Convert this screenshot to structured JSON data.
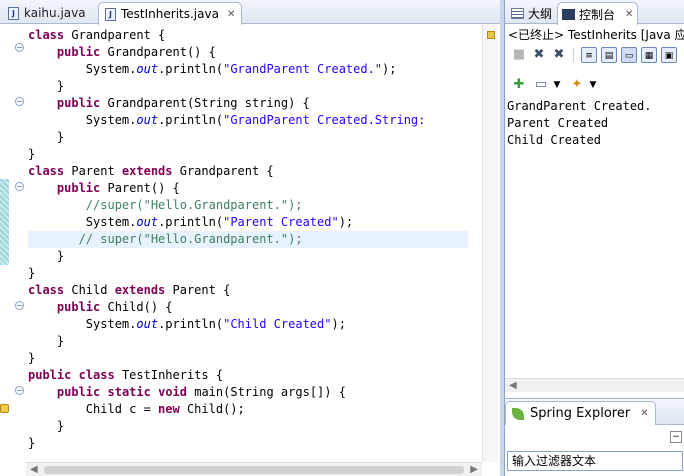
{
  "editor": {
    "tabs": [
      {
        "label": "kaihu.java",
        "active": false
      },
      {
        "label": "TestInherits.java",
        "active": true
      }
    ],
    "code": [
      [
        [
          "kw",
          "class"
        ],
        [
          "t",
          " Grandparent {"
        ]
      ],
      [
        [
          "t",
          "    "
        ],
        [
          "kw",
          "public"
        ],
        [
          "t",
          " Grandparent() {"
        ]
      ],
      [
        [
          "t",
          "        System."
        ],
        [
          "fld",
          "out"
        ],
        [
          "t",
          ".println("
        ],
        [
          "str",
          "\"GrandParent Created.\""
        ],
        [
          "t",
          ");"
        ]
      ],
      [
        [
          "t",
          "    }"
        ]
      ],
      [
        [
          "t",
          "    "
        ],
        [
          "kw",
          "public"
        ],
        [
          "t",
          " Grandparent(String string) {"
        ]
      ],
      [
        [
          "t",
          "        System."
        ],
        [
          "fld",
          "out"
        ],
        [
          "t",
          ".println("
        ],
        [
          "str",
          "\"GrandParent Created.String:"
        ]
      ],
      [
        [
          "t",
          "    }"
        ]
      ],
      [
        [
          "t",
          "}"
        ]
      ],
      [
        [
          "kw",
          "class"
        ],
        [
          "t",
          " Parent "
        ],
        [
          "kw",
          "extends"
        ],
        [
          "t",
          " Grandparent {"
        ]
      ],
      [
        [
          "t",
          "    "
        ],
        [
          "kw",
          "public"
        ],
        [
          "t",
          " Parent() {"
        ]
      ],
      [
        [
          "t",
          "        "
        ],
        [
          "cmt",
          "//super(\"Hello.Grandparent.\");"
        ]
      ],
      [
        [
          "t",
          "        System."
        ],
        [
          "fld",
          "out"
        ],
        [
          "t",
          ".println("
        ],
        [
          "str",
          "\"Parent Created\""
        ],
        [
          "t",
          ");"
        ]
      ],
      [
        [
          "t",
          "       "
        ],
        [
          "cmt",
          "// super(\"Hello.Grandparent.\");"
        ]
      ],
      [
        [
          "t",
          "    }"
        ]
      ],
      [
        [
          "t",
          "}"
        ]
      ],
      [
        [
          "kw",
          "class"
        ],
        [
          "t",
          " Child "
        ],
        [
          "kw",
          "extends"
        ],
        [
          "t",
          " Parent {"
        ]
      ],
      [
        [
          "t",
          "    "
        ],
        [
          "kw",
          "public"
        ],
        [
          "t",
          " Child() {"
        ]
      ],
      [
        [
          "t",
          "        System."
        ],
        [
          "fld",
          "out"
        ],
        [
          "t",
          ".println("
        ],
        [
          "str",
          "\"Child Created\""
        ],
        [
          "t",
          ");"
        ]
      ],
      [
        [
          "t",
          "    }"
        ]
      ],
      [
        [
          "t",
          "}"
        ]
      ],
      [
        [
          "kw",
          "public"
        ],
        [
          "t",
          " "
        ],
        [
          "kw",
          "class"
        ],
        [
          "t",
          " TestInherits {"
        ]
      ],
      [
        [
          "t",
          "    "
        ],
        [
          "kw",
          "public"
        ],
        [
          "t",
          " "
        ],
        [
          "kw",
          "static"
        ],
        [
          "t",
          " "
        ],
        [
          "kw",
          "void"
        ],
        [
          "t",
          " main(String args[]) {"
        ]
      ],
      [
        [
          "t",
          "        Child c = "
        ],
        [
          "kw",
          "new"
        ],
        [
          "t",
          " Child();"
        ]
      ],
      [
        [
          "t",
          "    }"
        ]
      ],
      [
        [
          "t",
          "}"
        ]
      ]
    ],
    "highlighted_line": 12
  },
  "right_panel": {
    "tabs": [
      {
        "label": "大纲",
        "icon": "outline-icon",
        "active": false
      },
      {
        "label": "控制台",
        "icon": "console-icon",
        "active": true
      }
    ],
    "console_status": "<已终止> TestInherits [Java 应用",
    "output": [
      "GrandParent Created.",
      "Parent Created",
      "Child Created"
    ]
  },
  "spring_explorer": {
    "tab_label": "Spring Explorer",
    "filter_text": "输入过滤器文本"
  },
  "colors": {
    "keyword": "#7f0055",
    "string": "#2a00ff",
    "comment": "#3f7f5f",
    "field": "#0000c0",
    "line_highlight": "#e8f2fe"
  }
}
